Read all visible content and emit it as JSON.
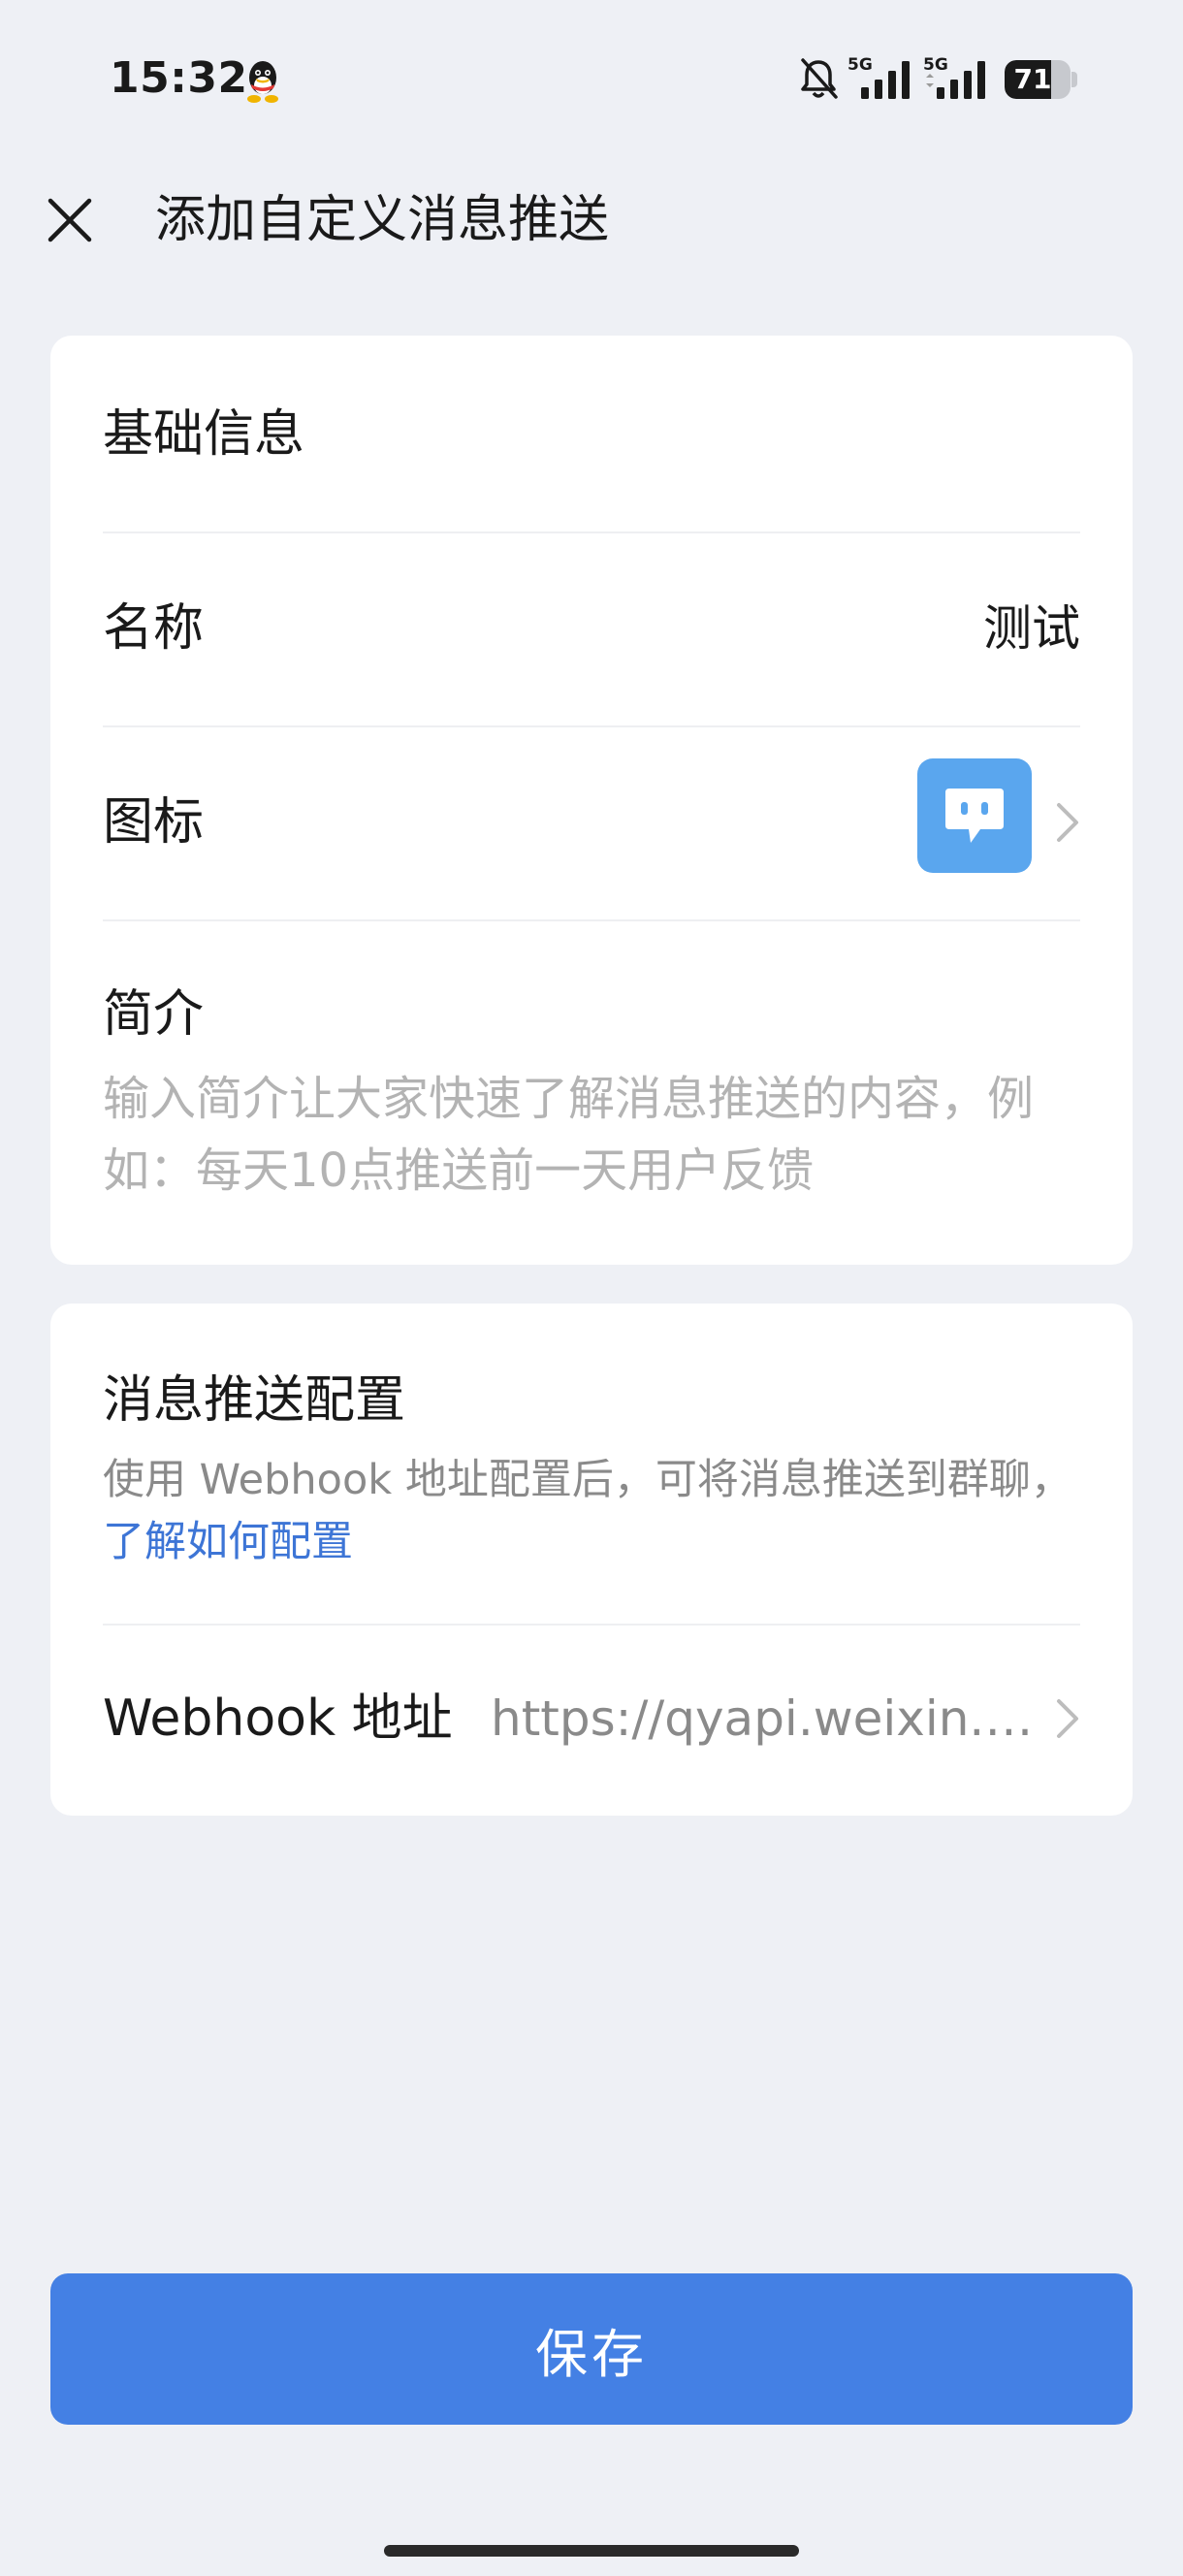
{
  "status_bar": {
    "time": "15:32",
    "battery_level": "71",
    "signal_1_label": "5G",
    "signal_2_label": "5G"
  },
  "header": {
    "title": "添加自定义消息推送"
  },
  "basic_info": {
    "section_title": "基础信息",
    "name_label": "名称",
    "name_value": "测试",
    "icon_label": "图标",
    "intro_label": "简介",
    "intro_placeholder": "输入简介让大家快速了解消息推送的内容，例如：每天10点推送前一天用户反馈"
  },
  "push_config": {
    "section_title": "消息推送配置",
    "description": "使用 Webhook 地址配置后，可将消息推送到群聊，",
    "help_link": "了解如何配置",
    "webhook_label": "Webhook 地址",
    "webhook_value": "https://qyapi.weixin.qq.com/cgi-bin/webhook/send"
  },
  "footer": {
    "save_label": "保存"
  },
  "colors": {
    "background": "#eef0f5",
    "primary": "#4480e4",
    "link": "#3d75d6",
    "icon_bg": "#5aa6ee"
  }
}
